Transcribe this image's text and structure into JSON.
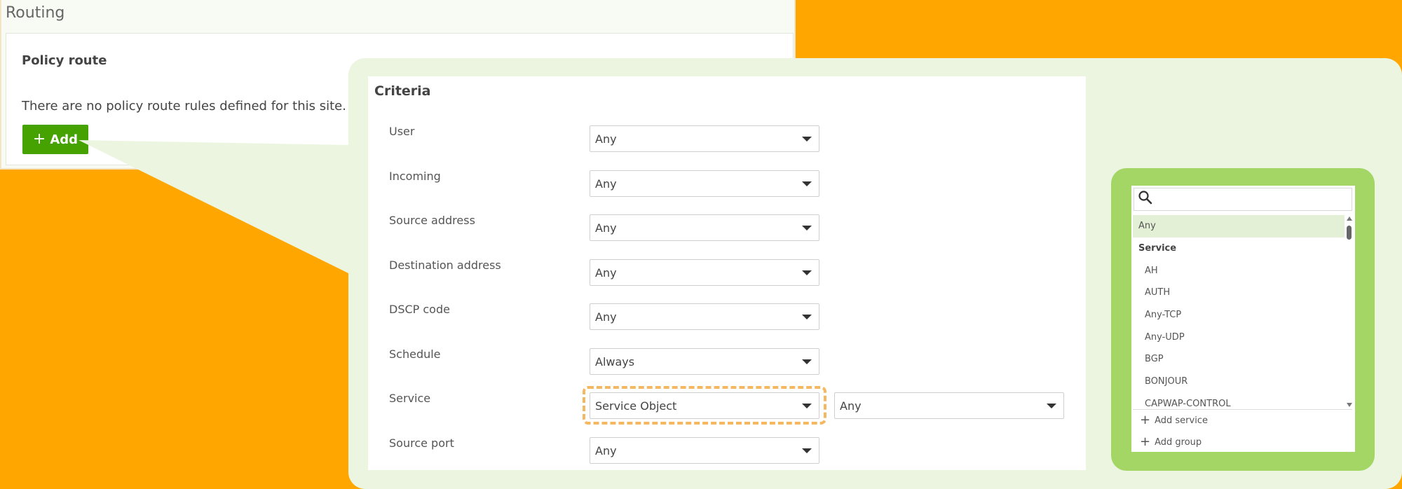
{
  "routing": {
    "title": "Routing",
    "policy_route": {
      "title": "Policy route",
      "empty_message": "There are no policy route rules defined for this site.",
      "add_label": "Add"
    }
  },
  "criteria": {
    "title": "Criteria",
    "fields": [
      {
        "label": "User",
        "value": "Any"
      },
      {
        "label": "Incoming",
        "value": "Any"
      },
      {
        "label": "Source address",
        "value": "Any"
      },
      {
        "label": "Destination address",
        "value": "Any"
      },
      {
        "label": "DSCP code",
        "value": "Any"
      },
      {
        "label": "Schedule",
        "value": "Always"
      },
      {
        "label": "Service",
        "value": "Service Object",
        "secondary_value": "Any"
      },
      {
        "label": "Source port",
        "value": "Any"
      }
    ]
  },
  "service_popup": {
    "search_value": "",
    "items": [
      {
        "label": "Any",
        "kind": "option",
        "selected": true
      },
      {
        "label": "Service",
        "kind": "group"
      },
      {
        "label": "AH",
        "kind": "option"
      },
      {
        "label": "AUTH",
        "kind": "option"
      },
      {
        "label": "Any-TCP",
        "kind": "option"
      },
      {
        "label": "Any-UDP",
        "kind": "option"
      },
      {
        "label": "BGP",
        "kind": "option"
      },
      {
        "label": "BONJOUR",
        "kind": "option"
      },
      {
        "label": "CAPWAP-CONTROL",
        "kind": "option"
      }
    ],
    "add_service_label": "Add service",
    "add_group_label": "Add group"
  },
  "colors": {
    "background": "#FFA600",
    "accent_green": "#45A200",
    "callout_green": "#EBF5E0",
    "popup_frame_green": "#A3D664",
    "highlight_dash": "#F4B860"
  }
}
